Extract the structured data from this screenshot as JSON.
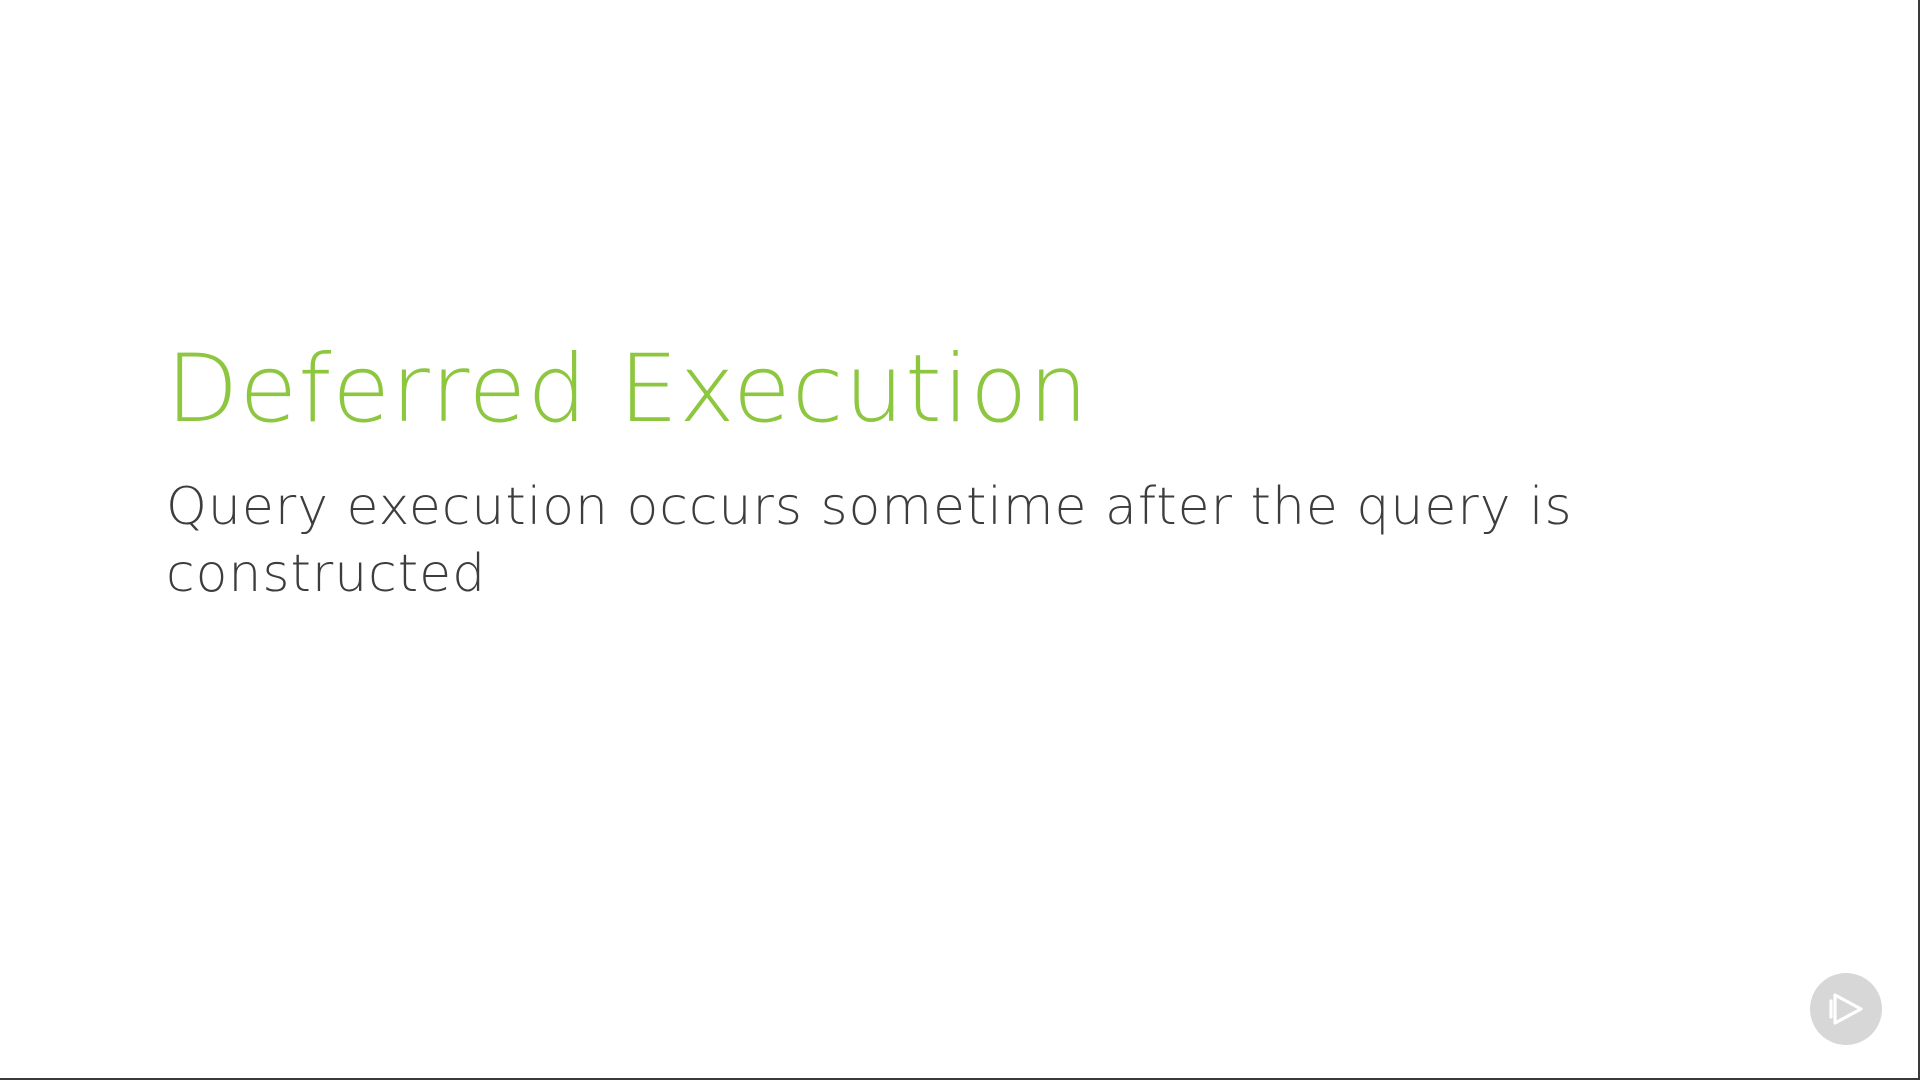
{
  "slide": {
    "title": "Deferred Execution",
    "subtitle_line1": "Query execution occurs sometime after the query is",
    "subtitle_line2": "constructed"
  },
  "branding": {
    "logo_icon": "play-logo-icon"
  },
  "colors": {
    "title": "#8dc63f",
    "body_text": "#3d3d3d",
    "logo_background": "#d7d7d7"
  }
}
